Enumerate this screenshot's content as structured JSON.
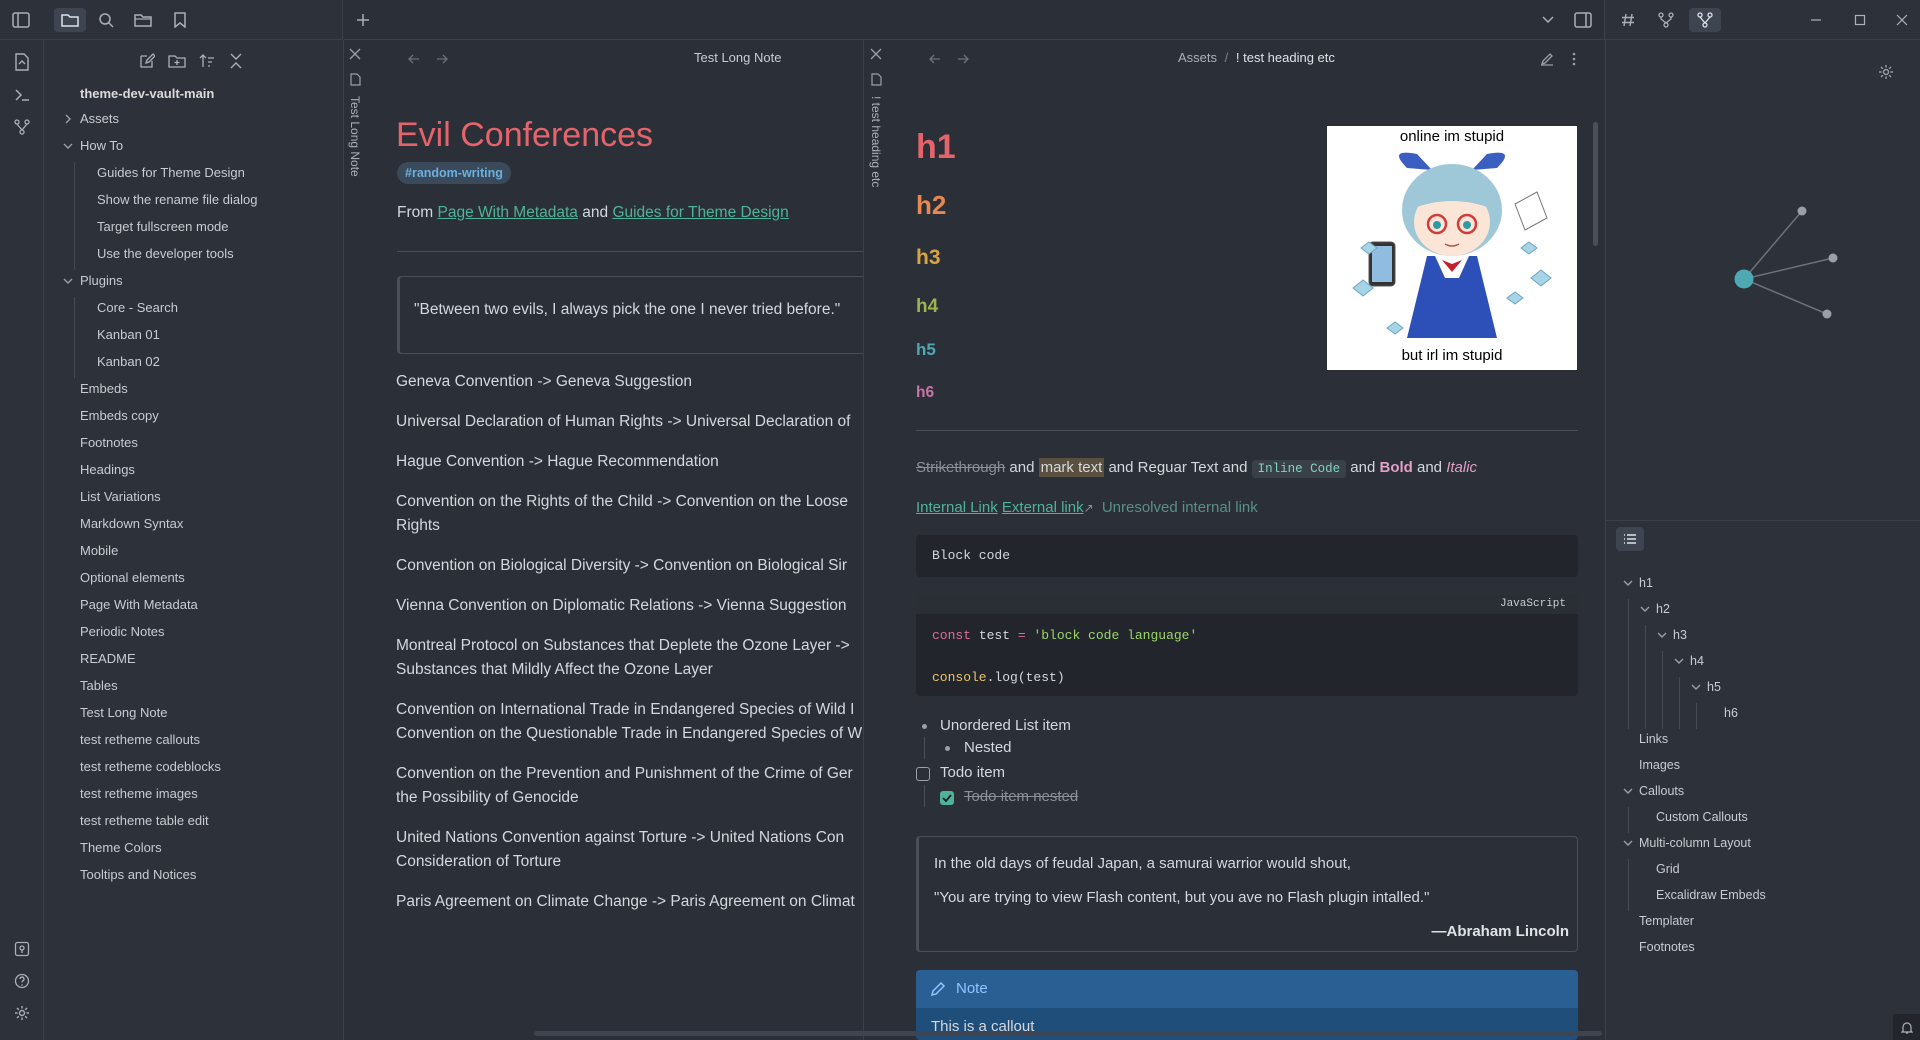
{
  "explorer": {
    "vault_name": "theme-dev-vault-main",
    "items": [
      {
        "label": "Assets",
        "depth": 0,
        "arrow": "right"
      },
      {
        "label": "How To",
        "depth": 0,
        "arrow": "down"
      },
      {
        "label": "Guides for Theme Design",
        "depth": 1
      },
      {
        "label": "Show the rename file dialog",
        "depth": 1
      },
      {
        "label": "Target fullscreen mode",
        "depth": 1
      },
      {
        "label": "Use the developer tools",
        "depth": 1
      },
      {
        "label": "Plugins",
        "depth": 0,
        "arrow": "down"
      },
      {
        "label": "Core - Search",
        "depth": 1
      },
      {
        "label": "Kanban 01",
        "depth": 1
      },
      {
        "label": "Kanban 02",
        "depth": 1
      },
      {
        "label": "Embeds",
        "depth": 0
      },
      {
        "label": "Embeds copy",
        "depth": 0
      },
      {
        "label": "Footnotes",
        "depth": 0
      },
      {
        "label": "Headings",
        "depth": 0
      },
      {
        "label": "List Variations",
        "depth": 0
      },
      {
        "label": "Markdown Syntax",
        "depth": 0
      },
      {
        "label": "Mobile",
        "depth": 0
      },
      {
        "label": "Optional elements",
        "depth": 0
      },
      {
        "label": "Page With Metadata",
        "depth": 0
      },
      {
        "label": "Periodic Notes",
        "depth": 0
      },
      {
        "label": "README",
        "depth": 0
      },
      {
        "label": "Tables",
        "depth": 0
      },
      {
        "label": "Test Long Note",
        "depth": 0
      },
      {
        "label": "test retheme callouts",
        "depth": 0
      },
      {
        "label": "test retheme codeblocks",
        "depth": 0
      },
      {
        "label": "test retheme images",
        "depth": 0
      },
      {
        "label": "test retheme table edit",
        "depth": 0
      },
      {
        "label": "Theme Colors",
        "depth": 0
      },
      {
        "label": "Tooltips and Notices",
        "depth": 0
      }
    ]
  },
  "pane1": {
    "tab_title": "Test Long Note",
    "header_title": "Test Long Note",
    "title": "Evil Conferences",
    "tag": "#random-writing",
    "from_prefix": "From",
    "link1": "Page With Metadata",
    "and_text": "and",
    "link2": "Guides for Theme Design",
    "quote": "\"Between two evils, I always pick the one I never tried before.\"",
    "lines": [
      [
        "Geneva Convention -> Geneva Suggestion"
      ],
      [
        "Universal Declaration of Human Rights -> Universal Declaration of"
      ],
      [
        "Hague Convention -> Hague Recommendation"
      ],
      [
        "Convention on the Rights of the Child -> Convention on the Loose",
        "Rights"
      ],
      [
        "Convention on Biological Diversity -> Convention on Biological Sir"
      ],
      [
        "Vienna Convention on Diplomatic Relations -> Vienna Suggestion"
      ],
      [
        "Montreal Protocol on Substances that Deplete the Ozone Layer ->",
        "Substances that Mildly Affect the Ozone Layer"
      ],
      [
        "Convention on International Trade in Endangered Species of Wild I",
        "Convention on the Questionable Trade in Endangered Species of W"
      ],
      [
        "Convention on the Prevention and Punishment of the Crime of Ger",
        "the Possibility of Genocide"
      ],
      [
        "United Nations Convention against Torture -> United Nations Con",
        "Consideration of Torture"
      ],
      [
        "Paris Agreement on Climate Change -> Paris Agreement on Climat"
      ]
    ]
  },
  "pane2": {
    "tab_title": "! test heading etc",
    "breadcrumb_parent": "Assets",
    "breadcrumb_sep": "/",
    "breadcrumb_current": "! test heading etc",
    "headings": [
      "h1",
      "h2",
      "h3",
      "h4",
      "h5",
      "h6"
    ],
    "heading_colors": [
      "#e5636b",
      "#e8874f",
      "#d9a441",
      "#9bb351",
      "#4fa9b3",
      "#c874a8"
    ],
    "image_top_text": "online im stupid",
    "image_bottom_text": "but irl im stupid",
    "strike": "Strikethrough",
    "and1": " and ",
    "mark": "mark text",
    "regular": " and Reguar Text and ",
    "inline_code": "Inline Code",
    "and2": " and ",
    "bold": "Bold",
    "and3": " and ",
    "italic": "Italic",
    "internal_link": "Internal Link",
    "external_link": "External link",
    "unresolved": "Unresolved internal link",
    "block_code": "Block code",
    "code_lang": "JavaScript",
    "code_kw": "const",
    "code_var": " test ",
    "code_eq": "=",
    "code_str": "'block code language'",
    "code_line2_fn": "console",
    "code_line2_rest": ".log(test)",
    "list_item": "Unordered List item",
    "nested": "Nested",
    "todo": "Todo item",
    "todo_nested": "Todo item nested",
    "quote_line1": "In the old days of feudal Japan, a samurai warrior would shout,",
    "quote_line2": "\"You are trying to view Flash content, but you ave no Flash plugin intalled.\"",
    "quote_attr": "—Abraham Lincoln",
    "callout_title": "Note",
    "callout_body": "This is a callout"
  },
  "outline": {
    "items": [
      {
        "label": "h1",
        "depth": 0,
        "arrow": true
      },
      {
        "label": "h2",
        "depth": 1,
        "arrow": true
      },
      {
        "label": "h3",
        "depth": 2,
        "arrow": true
      },
      {
        "label": "h4",
        "depth": 3,
        "arrow": true
      },
      {
        "label": "h5",
        "depth": 4,
        "arrow": true
      },
      {
        "label": "h6",
        "depth": 5,
        "arrow": false
      },
      {
        "label": "Links",
        "depth": 0,
        "arrow": false
      },
      {
        "label": "Images",
        "depth": 0,
        "arrow": false
      },
      {
        "label": "Callouts",
        "depth": 0,
        "arrow": true
      },
      {
        "label": "Custom Callouts",
        "depth": 1,
        "arrow": false
      },
      {
        "label": "Multi-column Layout",
        "depth": 0,
        "arrow": true
      },
      {
        "label": "Grid",
        "depth": 1,
        "arrow": false
      },
      {
        "label": "Excalidraw Embeds",
        "depth": 1,
        "arrow": false
      },
      {
        "label": "Templater",
        "depth": 0,
        "arrow": false
      },
      {
        "label": "Footnotes",
        "depth": 0,
        "arrow": false
      }
    ]
  },
  "colors": {
    "accent": "#4fb39a",
    "title_red": "#e5636b",
    "callout_blue": "#1f4e7a"
  }
}
